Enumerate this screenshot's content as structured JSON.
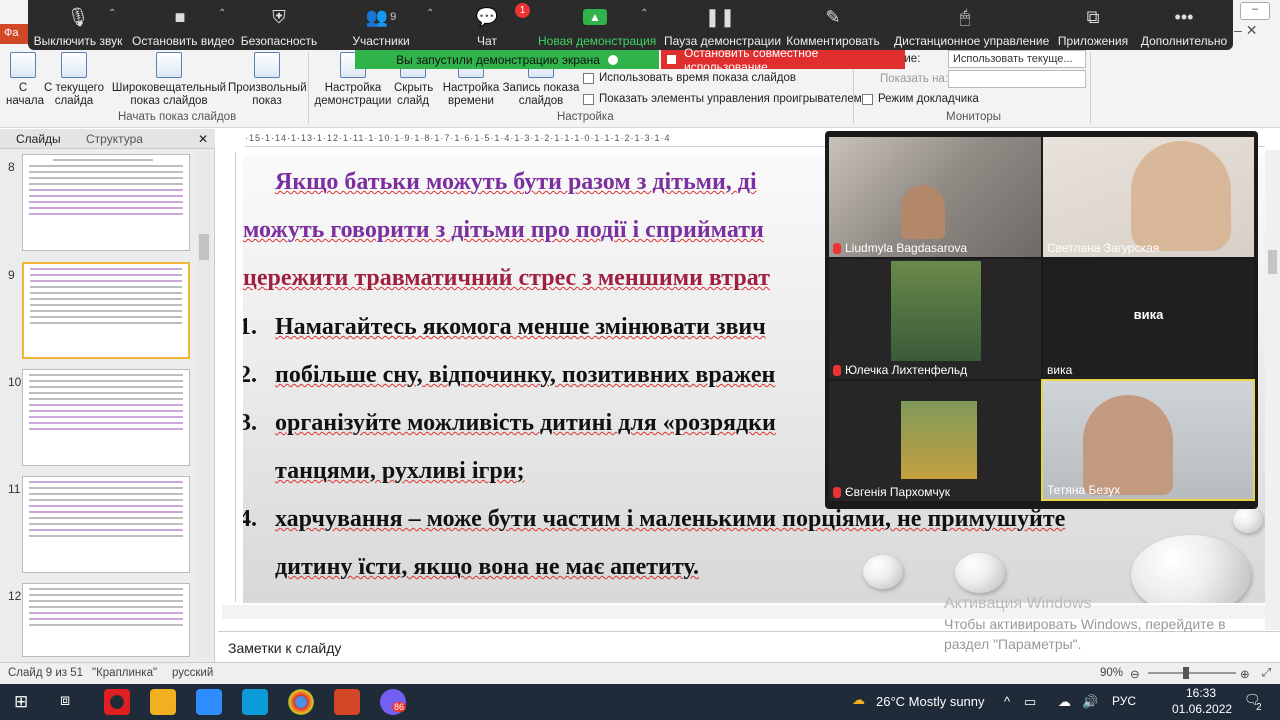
{
  "zoom_toolbar": {
    "mute_label": "Выключить звук",
    "video_label": "Остановить видео",
    "security_label": "Безопасность",
    "participants_label": "Участники",
    "participants_count": "9",
    "chat_label": "Чат",
    "chat_badge": "1",
    "new_share_label": "Новая демонстрация",
    "pause_share_label": "Пауза демонстрации",
    "annotate_label": "Комментировать",
    "remote_label": "Дистанционное управление",
    "apps_label": "Приложения",
    "more_label": "Дополнительно"
  },
  "share_banner": {
    "status_text": "Вы запустили демонстрацию экрана",
    "stop_text": "Остановить совместное использование"
  },
  "ribbon": {
    "file_tab": "Фа",
    "btn_from_start": "С\nначала",
    "btn_from_current": "С текущего\nслайда",
    "btn_broadcast": "Широковещательный\nпоказ слайдов",
    "btn_custom": "Произвольный\nпоказ",
    "group_start": "Начать показ слайдов",
    "btn_setup": "Настройка\nдемонстрации",
    "btn_hide": "Скрыть\nслайд",
    "btn_timings": "Настройка\nвремени",
    "btn_record": "Запись показа\nслайдов",
    "chk_use_timings": "Использовать время показа слайдов",
    "chk_show_controls": "Показать элементы управления проигрывателем",
    "group_setup": "Настройка",
    "resolution_label": "ешение:",
    "resolution_value": "Использовать текуще...",
    "show_on_label": "Показать на:",
    "presenter_view": "Режим докладчика",
    "group_monitors": "Мониторы"
  },
  "slide_panel": {
    "tab_slides": "Слайды",
    "tab_outline": "Структура",
    "slide_numbers": [
      "8",
      "9",
      "10",
      "11",
      "12"
    ]
  },
  "ruler_text": "·15·1·14·1·13·1·12·1·11·1·10·1·9·1·8·1·7·1·6·1·5·1·4·1·3·1·2·1·1·1·0·1·1·1·2·1·3·1·4",
  "slide": {
    "line1": "Якщо батьки можуть бути разом з дітьми, ді",
    "line2": "можуть говорити з дітьми про події і сприймати",
    "line3": "цережити травматичний стрес з меншими втрат",
    "item1": "Намагайтесь якомога менше змінювати звич",
    "item1_num": "1.",
    "item2": "побільше сну, відпочинку, позитивних вражен",
    "item2_num": "2.",
    "item3a": "організуйте можливість дитині для «розрядки",
    "item3_num": "3.",
    "item3b": "танцями, рухливі ігри;",
    "item4a": "харчування – може бути частим і маленькими порціями, не примушуйте",
    "item4_num": "4.",
    "item4b": "дитину їсти, якщо вона не має апетиту."
  },
  "notes_placeholder": "Заметки к слайду",
  "activation": {
    "title": "Активация Windows",
    "line1": "Чтобы активировать Windows, перейдите в",
    "line2": "раздел \"Параметры\"."
  },
  "gallery": {
    "participants": [
      {
        "name": "Liudmyla Bagdasarova",
        "muted": true
      },
      {
        "name": "Светлана Загурская",
        "muted": false
      },
      {
        "name": "Юлечка Лихтенфельд",
        "muted": true
      },
      {
        "name": "вика",
        "muted": false,
        "center_label": "вика"
      },
      {
        "name": "Євгенія Пархомчук",
        "muted": true
      },
      {
        "name": "Тетяна Безух",
        "muted": false
      }
    ]
  },
  "status_bar": {
    "slide_info": "Слайд 9 из 51",
    "theme": "\"Краплинка\"",
    "language": "русский",
    "zoom": "90%"
  },
  "taskbar": {
    "weather": "26°C  Mostly sunny",
    "lang": "РУС",
    "time": "16:33",
    "date": "01.06.2022",
    "notif_count": "2",
    "viber_badge": "86"
  },
  "colors": {
    "zoom_green": "#2fb34a",
    "zoom_red": "#e02e2e",
    "slide_purple": "#7c2f9e",
    "ppt_red": "#d24726",
    "active_speaker": "#e8d64a"
  }
}
